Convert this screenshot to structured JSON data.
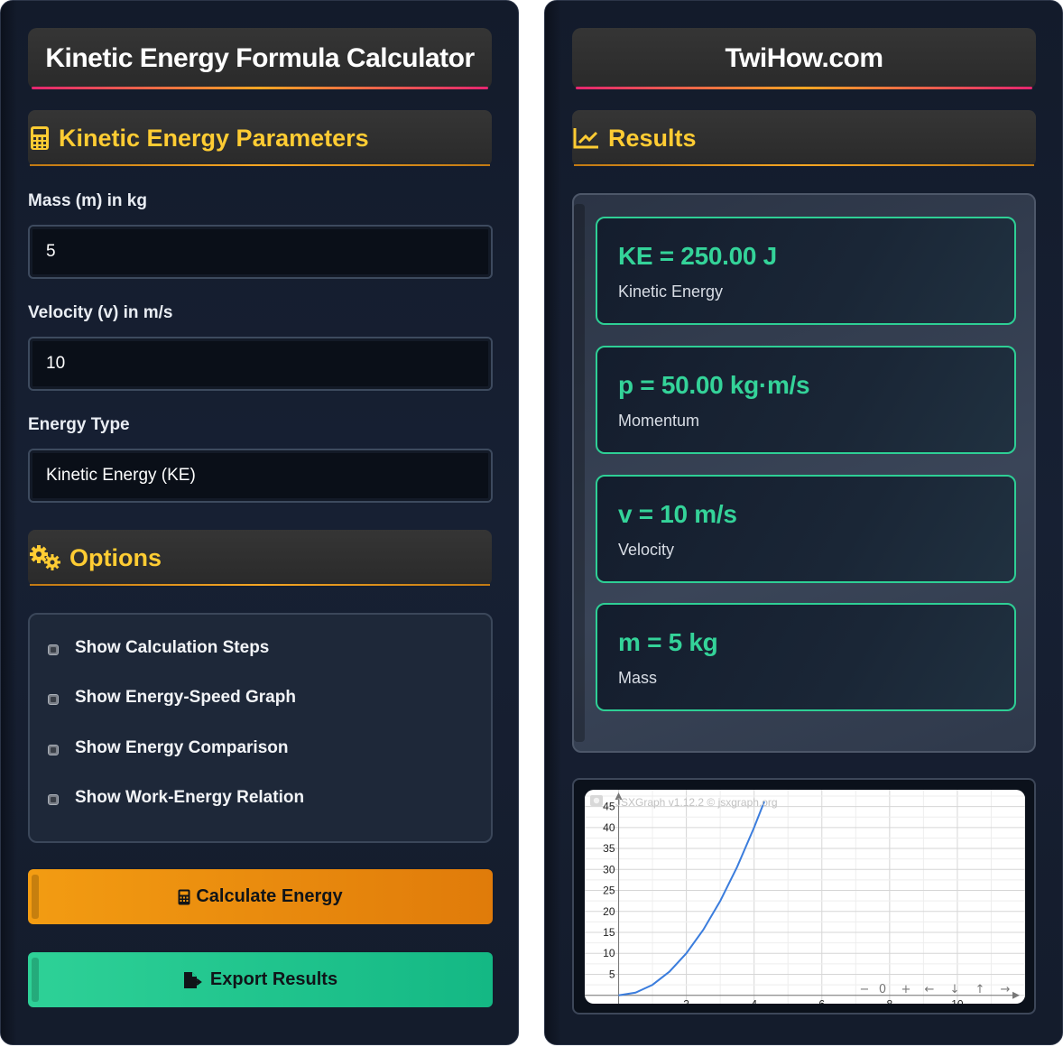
{
  "left": {
    "title": "Kinetic Energy Formula Calculator",
    "params_heading": "Kinetic Energy Parameters",
    "mass_label": "Mass (m) in kg",
    "mass_value": "5",
    "velocity_label": "Velocity (v) in m/s",
    "velocity_value": "10",
    "energy_type_label": "Energy Type",
    "energy_type_value": "Kinetic Energy (KE)",
    "options_heading": "Options",
    "options": [
      {
        "label": "Show Calculation Steps"
      },
      {
        "label": "Show Energy-Speed Graph"
      },
      {
        "label": "Show Energy Comparison"
      },
      {
        "label": "Show Work-Energy Relation"
      }
    ],
    "calculate_label": "Calculate Energy",
    "export_label": "Export Results"
  },
  "right": {
    "title": "TwiHow.com",
    "results_heading": "Results",
    "results": [
      {
        "value": "KE = 250.00 J",
        "label": "Kinetic Energy"
      },
      {
        "value": "p = 50.00 kg·m/s",
        "label": "Momentum"
      },
      {
        "value": "v = 10 m/s",
        "label": "Velocity"
      },
      {
        "value": "m = 5 kg",
        "label": "Mass"
      }
    ],
    "graph_credit": "JSXGraph v1.12.2 © jsxgraph.org",
    "graph_nav": [
      "−",
      "0",
      "+",
      "←",
      "↓",
      "↑",
      "→"
    ]
  },
  "colors": {
    "accent_yellow": "#ffcc33",
    "result_green": "#34d399",
    "calc_orange": "#f39c12",
    "export_green": "#2ed197",
    "curve_blue": "#3b7ddd"
  },
  "chart_data": {
    "type": "line",
    "series": [
      {
        "x": [
          0,
          0.5,
          1,
          1.5,
          2,
          2.5,
          3,
          3.5,
          4,
          4.3
        ],
        "y": [
          0,
          0.625,
          2.5,
          5.625,
          10,
          15.625,
          22.5,
          30.625,
          40,
          46.2
        ]
      }
    ],
    "x_ticks": [
      "2",
      "4",
      "6",
      "8",
      "10"
    ],
    "y_ticks": [
      "5",
      "10",
      "15",
      "20",
      "25",
      "30",
      "35",
      "40",
      "45"
    ],
    "xlim": [
      -1,
      12
    ],
    "ylim": [
      -2,
      49
    ],
    "grid": true
  }
}
